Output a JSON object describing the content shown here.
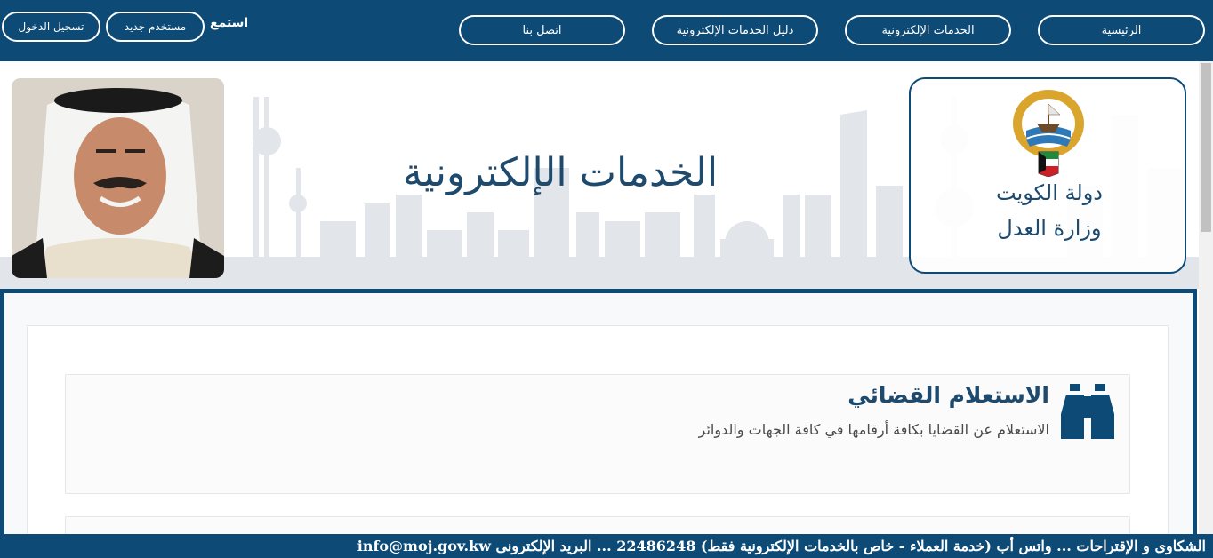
{
  "nav": {
    "home": "الرئيسية",
    "eservices": "الخدمات الإلكترونية",
    "guide": "دليل الخدمات الإلكترونية",
    "contact": "اتصل بنا",
    "listen": "استمع",
    "new_user": "مستخدم جديد",
    "login": "تسجيل الدخول"
  },
  "banner": {
    "title": "الخدمات الإلكترونية",
    "logo_line1": "دولة الكويت",
    "logo_line2": "وزارة العدل"
  },
  "cards": [
    {
      "title": "الاستعلام القضائي",
      "description": "الاستعلام عن القضايا بكافة أرقامها في كافة الجهات والدوائر",
      "icon": "binoculars-icon"
    }
  ],
  "ticker": {
    "text": "الشكاوى و الإقتراحات ... واتس أب (خدمة العملاء - خاص بالخدمات الإلكترونية فقط) 22486248 ... البريد الإلكترونى info@moj.gov.kw"
  },
  "colors": {
    "primary": "#0d4a76",
    "title": "#1e4a6e",
    "skyline": "#d9dde2"
  }
}
